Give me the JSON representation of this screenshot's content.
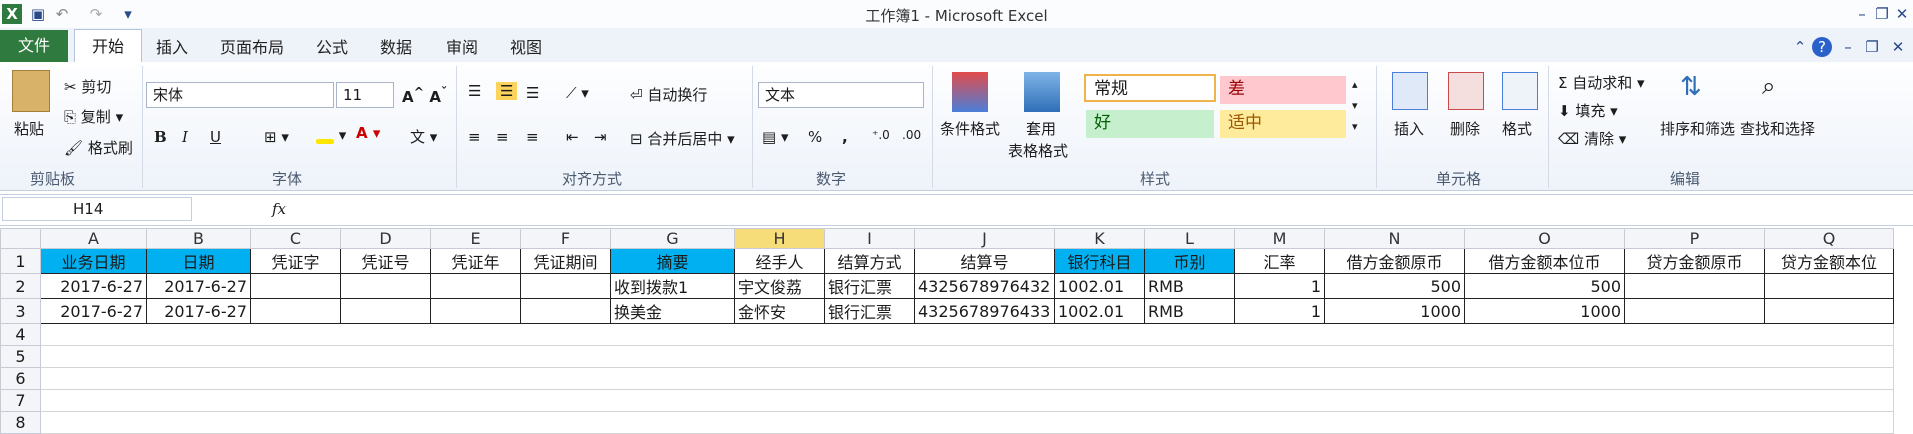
{
  "window": {
    "title": "工作簿1 - Microsoft Excel"
  },
  "tabs": [
    "文件",
    "开始",
    "插入",
    "页面布局",
    "公式",
    "数据",
    "审阅",
    "视图"
  ],
  "clipboard": {
    "paste": "粘贴",
    "cut": "剪切",
    "copy": "复制",
    "format_painter": "格式刷",
    "group": "剪贴板"
  },
  "font": {
    "name": "宋体",
    "size": "11",
    "bold": "B",
    "italic": "I",
    "underline": "U",
    "group": "字体"
  },
  "alignment": {
    "wrap": "自动换行",
    "merge": "合并后居中",
    "group": "对齐方式"
  },
  "number": {
    "format": "文本",
    "percent": "%",
    "comma": ",",
    "group": "数字"
  },
  "styles": {
    "conditional": "条件格式",
    "table_line1": "套用",
    "table_line2": "表格格式",
    "normal": "常规",
    "bad": "差",
    "good": "好",
    "neutral": "适中",
    "group": "样式"
  },
  "cells": {
    "insert": "插入",
    "delete": "删除",
    "format": "格式",
    "group": "单元格"
  },
  "editing": {
    "autosum": "自动求和",
    "fill": "填充",
    "clear": "清除",
    "sort": "排序和筛选",
    "find": "查找和选择",
    "group": "编辑"
  },
  "formula_bar": {
    "name_box": "H14",
    "fx": "fx",
    "formula": ""
  },
  "columns": [
    "A",
    "B",
    "C",
    "D",
    "E",
    "F",
    "G",
    "H",
    "I",
    "J",
    "K",
    "L",
    "M",
    "N",
    "O",
    "P",
    "Q"
  ],
  "header_row": [
    "业务日期",
    "日期",
    "凭证字",
    "凭证号",
    "凭证年",
    "凭证期间",
    "摘要",
    "经手人",
    "结算方式",
    "结算号",
    "银行科目",
    "币别",
    "汇率",
    "借方金额原币",
    "借方金额本位币",
    "贷方金额原币",
    "贷方金额本位"
  ],
  "rows": [
    [
      "2017-6-27",
      "2017-6-27",
      "",
      "",
      "",
      "",
      "收到拨款1",
      "宇文俊荔",
      "银行汇票",
      "4325678976432",
      "1002.01",
      "RMB",
      "1",
      "500",
      "500",
      "",
      ""
    ],
    [
      "2017-6-27",
      "2017-6-27",
      "",
      "",
      "",
      "",
      "换美金",
      "金怀安",
      "银行汇票",
      "4325678976433",
      "1002.01",
      "RMB",
      "1",
      "1000",
      "1000",
      "",
      ""
    ]
  ],
  "row_numbers": [
    "1",
    "2",
    "3",
    "4",
    "5",
    "6",
    "7",
    "8"
  ],
  "colors": {
    "header_fill": "#00b0f0",
    "file_tab": "#2f7a3e",
    "bad_fill": "#ffc7ce",
    "good_fill": "#c6efce",
    "neutral_fill": "#ffeb9c"
  }
}
